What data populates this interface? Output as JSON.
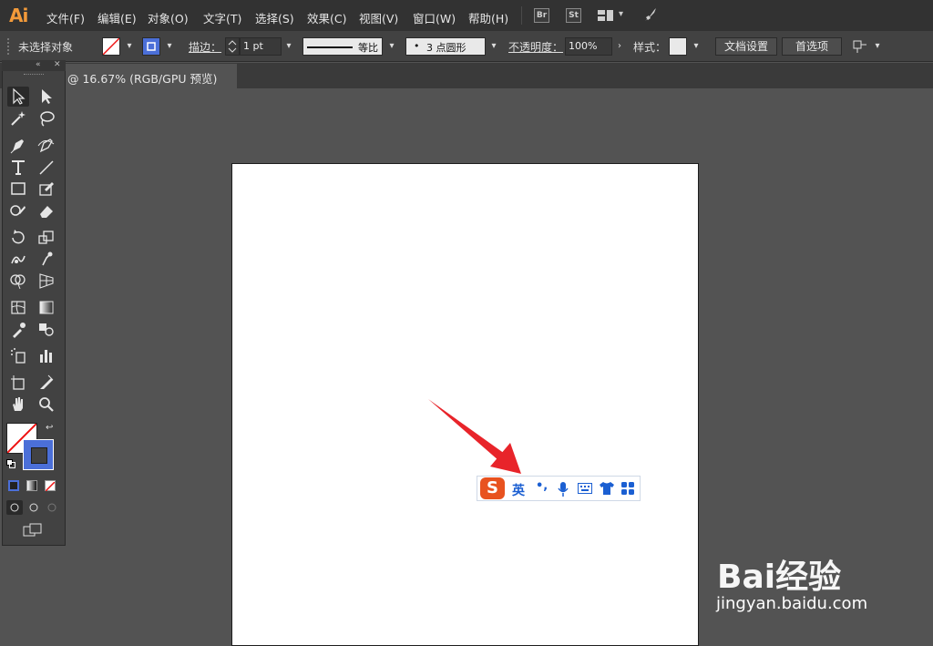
{
  "app": {
    "logo": "Ai"
  },
  "menu": [
    "文件(F)",
    "编辑(E)",
    "对象(O)",
    "文字(T)",
    "选择(S)",
    "效果(C)",
    "视图(V)",
    "窗口(W)",
    "帮助(H)"
  ],
  "menubar_icons": {
    "bridge": "Br",
    "stock": "St"
  },
  "control": {
    "selection_status": "未选择对象",
    "stroke_label": "描边：",
    "stroke_weight": "1 pt",
    "stroke_profile": "等比",
    "brush_label": "3 点圆形",
    "brush_dot": "•",
    "opacity_label": "不透明度：",
    "opacity_value": "100%",
    "style_label": "样式：",
    "doc_setup": "文档设置",
    "preferences": "首选项"
  },
  "document": {
    "tab_title": "@ 16.67% (RGB/GPU 预览)"
  },
  "ime": {
    "logo": "S",
    "lang": "英",
    "punct": "•,",
    "colors": {
      "brand": "#e8521f",
      "icon": "#1b5fd2"
    }
  },
  "watermark": {
    "text": "Bai经验",
    "url": "jingyan.baidu.com"
  },
  "tools": [
    "selection-tool",
    "direct-selection-tool",
    "magic-wand-tool",
    "lasso-tool",
    "pen-tool",
    "curvature-tool",
    "type-tool",
    "line-segment-tool",
    "rectangle-tool",
    "shaper-tool",
    "paintbrush-tool",
    "eraser-tool",
    "rotate-tool",
    "scale-tool",
    "warp-tool",
    "puppet-warp-tool",
    "shape-builder-tool",
    "perspective-grid-tool",
    "mesh-tool",
    "gradient-tool",
    "eyedropper-tool",
    "blend-tool",
    "symbol-sprayer-tool",
    "column-graph-tool",
    "artboard-tool",
    "slice-tool",
    "hand-tool",
    "zoom-tool"
  ]
}
